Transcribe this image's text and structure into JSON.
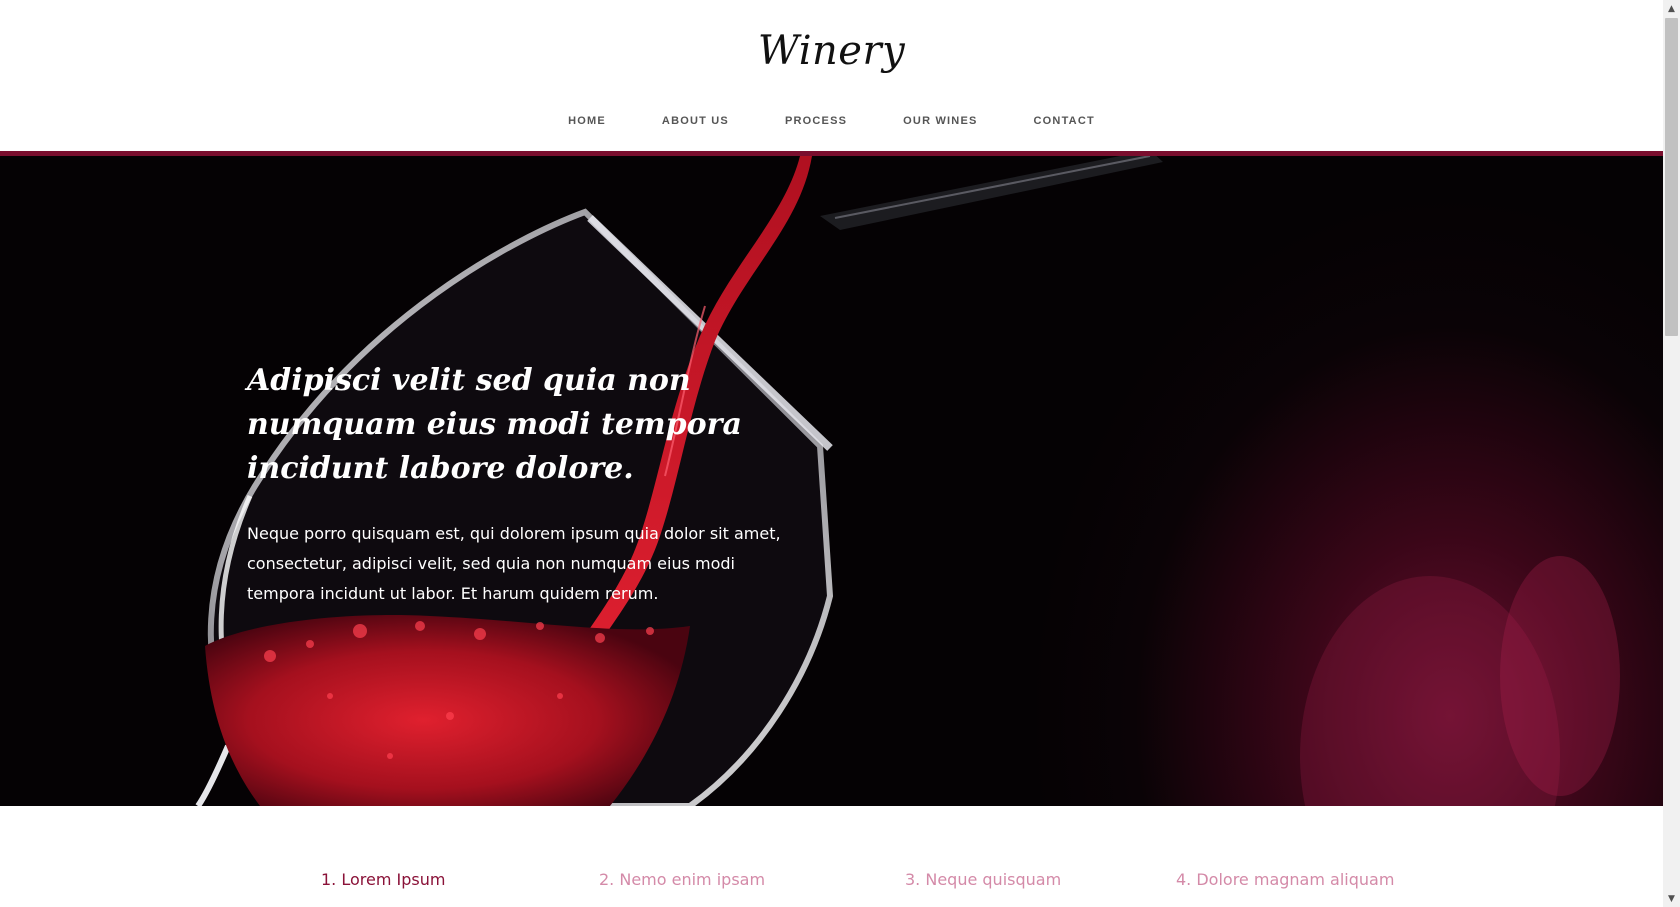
{
  "brand": {
    "logo": "Winery",
    "accent_color": "#7a0e2e"
  },
  "nav": {
    "items": [
      {
        "label": "HOME"
      },
      {
        "label": "ABOUT US"
      },
      {
        "label": "PROCESS"
      },
      {
        "label": "OUR WINES"
      },
      {
        "label": "CONTACT"
      }
    ]
  },
  "hero": {
    "title": "Adipisci velit sed quia non numquam eius modi tempora incidunt labore dolore.",
    "body": "Neque porro quisquam est, qui dolorem ipsum quia dolor sit amet, consectetur, adipisci velit, sed quia non numquam eius modi tempora incidunt ut labor. Et harum quidem rerum.",
    "image": "wine-glass-pour"
  },
  "tabs": {
    "items": [
      {
        "label": "1. Lorem Ipsum",
        "active": true
      },
      {
        "label": "2.  Nemo enim ipsam",
        "active": false
      },
      {
        "label": "3. Neque quisquam",
        "active": false
      },
      {
        "label": "4. Dolore magnam aliquam",
        "active": false
      }
    ],
    "active_color": "#8a1238",
    "inactive_color": "#d48aa8"
  },
  "scrollbar": {
    "up_icon": "chevron-up-icon",
    "down_icon": "chevron-down-icon"
  }
}
